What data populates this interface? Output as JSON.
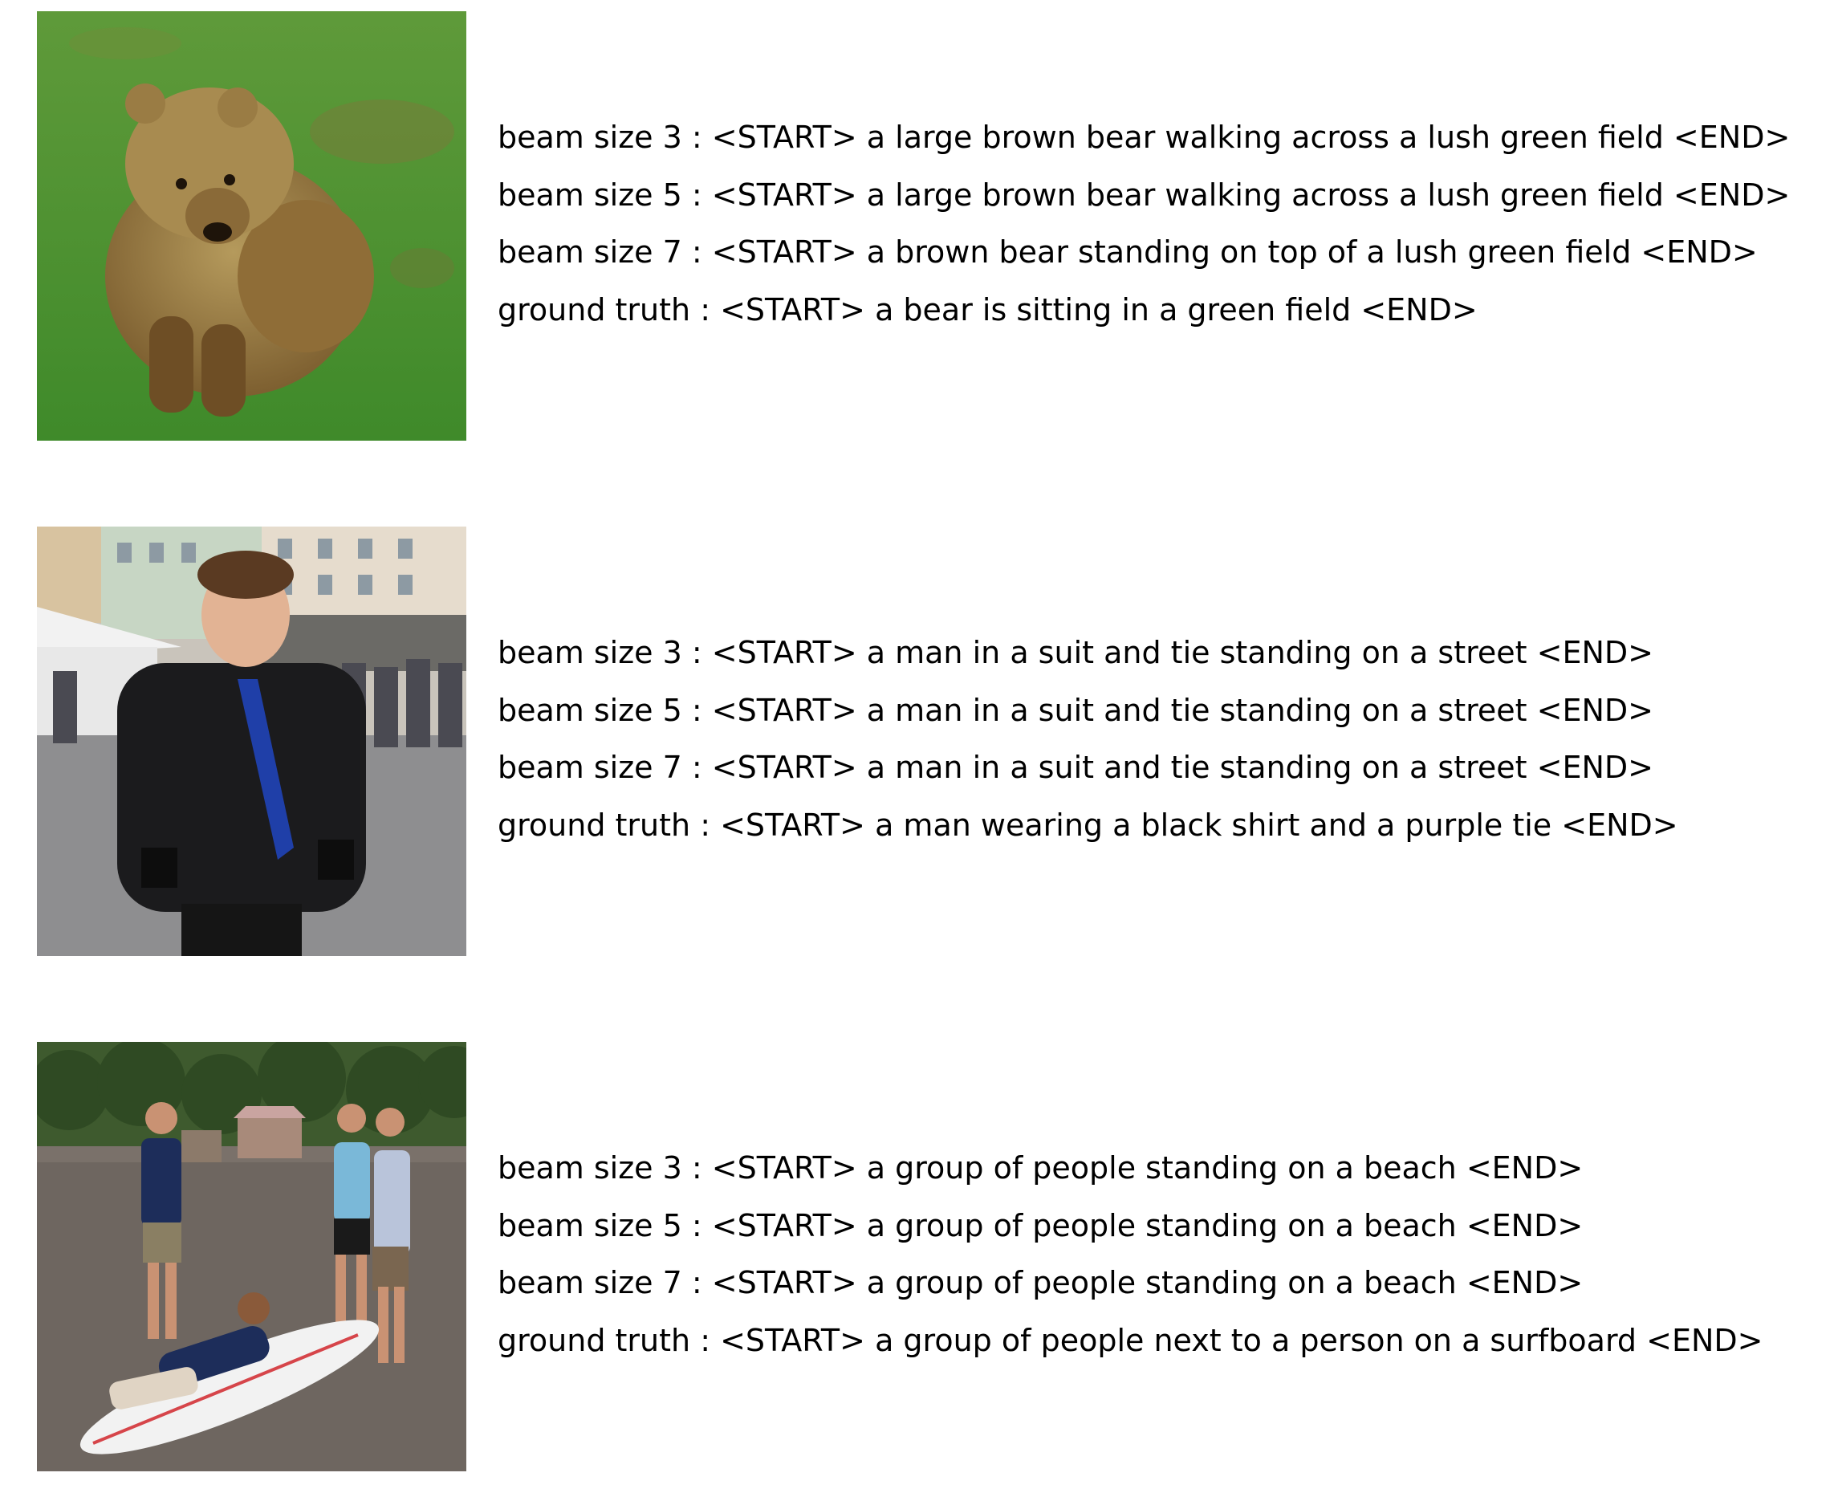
{
  "examples": [
    {
      "image_subject": "bear-photo",
      "captions": [
        "beam size 3 : <START> a large brown bear walking across a lush green field <END>",
        "beam size 5 : <START> a large brown bear walking across a lush green field <END>",
        "beam size 7 : <START> a brown bear standing on top of a lush green field <END>",
        "ground truth : <START> a bear is sitting in a green field <END>"
      ]
    },
    {
      "image_subject": "man-photo",
      "captions": [
        "beam size 3 : <START> a man in a suit and tie standing on a street <END>",
        "beam size 5 : <START> a man in a suit and tie standing on a street <END>",
        "beam size 7 : <START> a man in a suit and tie standing on a street <END>",
        "ground truth : <START> a man wearing a black shirt and a purple tie <END>"
      ]
    },
    {
      "image_subject": "beach-photo",
      "captions": [
        "beam size 3 : <START> a group of people standing on a beach <END>",
        "beam size 5 : <START> a group of people standing on a beach <END>",
        "beam size 7 : <START> a group of people standing on a beach <END>",
        "ground truth : <START> a group of people next to a person on a surfboard <END>"
      ]
    }
  ]
}
